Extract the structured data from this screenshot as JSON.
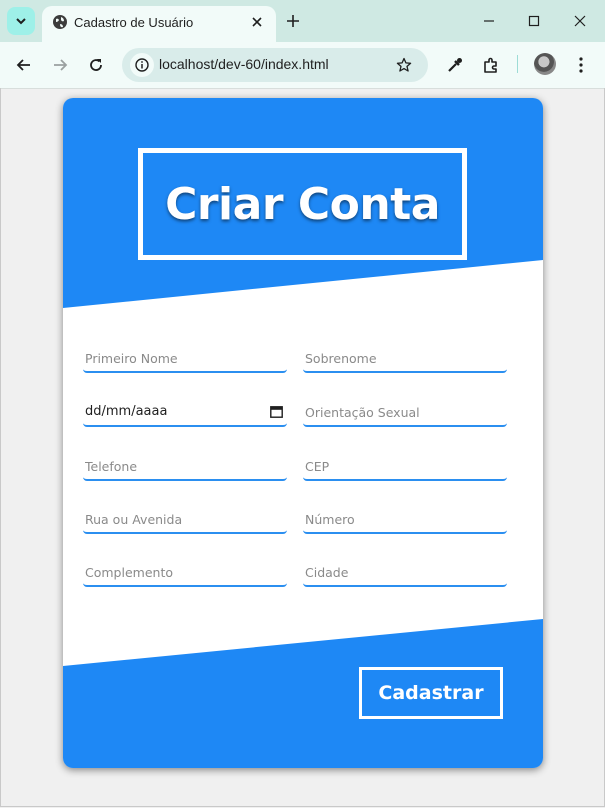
{
  "browser": {
    "tab_title": "Cadastro de Usuário",
    "url": "localhost/dev-60/index.html",
    "accent_color": "#cfe9e3"
  },
  "page": {
    "title": "Criar Conta",
    "primary_color": "#1e88f5",
    "fields": {
      "first_name": {
        "placeholder": "Primeiro Nome",
        "value": ""
      },
      "last_name": {
        "placeholder": "Sobrenome",
        "value": ""
      },
      "birth_date": {
        "display": "dd/mm/aaaa"
      },
      "orientation": {
        "placeholder": "Orientação Sexual",
        "value": ""
      },
      "phone": {
        "placeholder": "Telefone",
        "value": ""
      },
      "cep": {
        "placeholder": "CEP",
        "value": ""
      },
      "street": {
        "placeholder": "Rua ou Avenida",
        "value": ""
      },
      "number": {
        "placeholder": "Número",
        "value": ""
      },
      "complement": {
        "placeholder": "Complemento",
        "value": ""
      },
      "city": {
        "placeholder": "Cidade",
        "value": ""
      }
    },
    "submit_label": "Cadastrar"
  }
}
